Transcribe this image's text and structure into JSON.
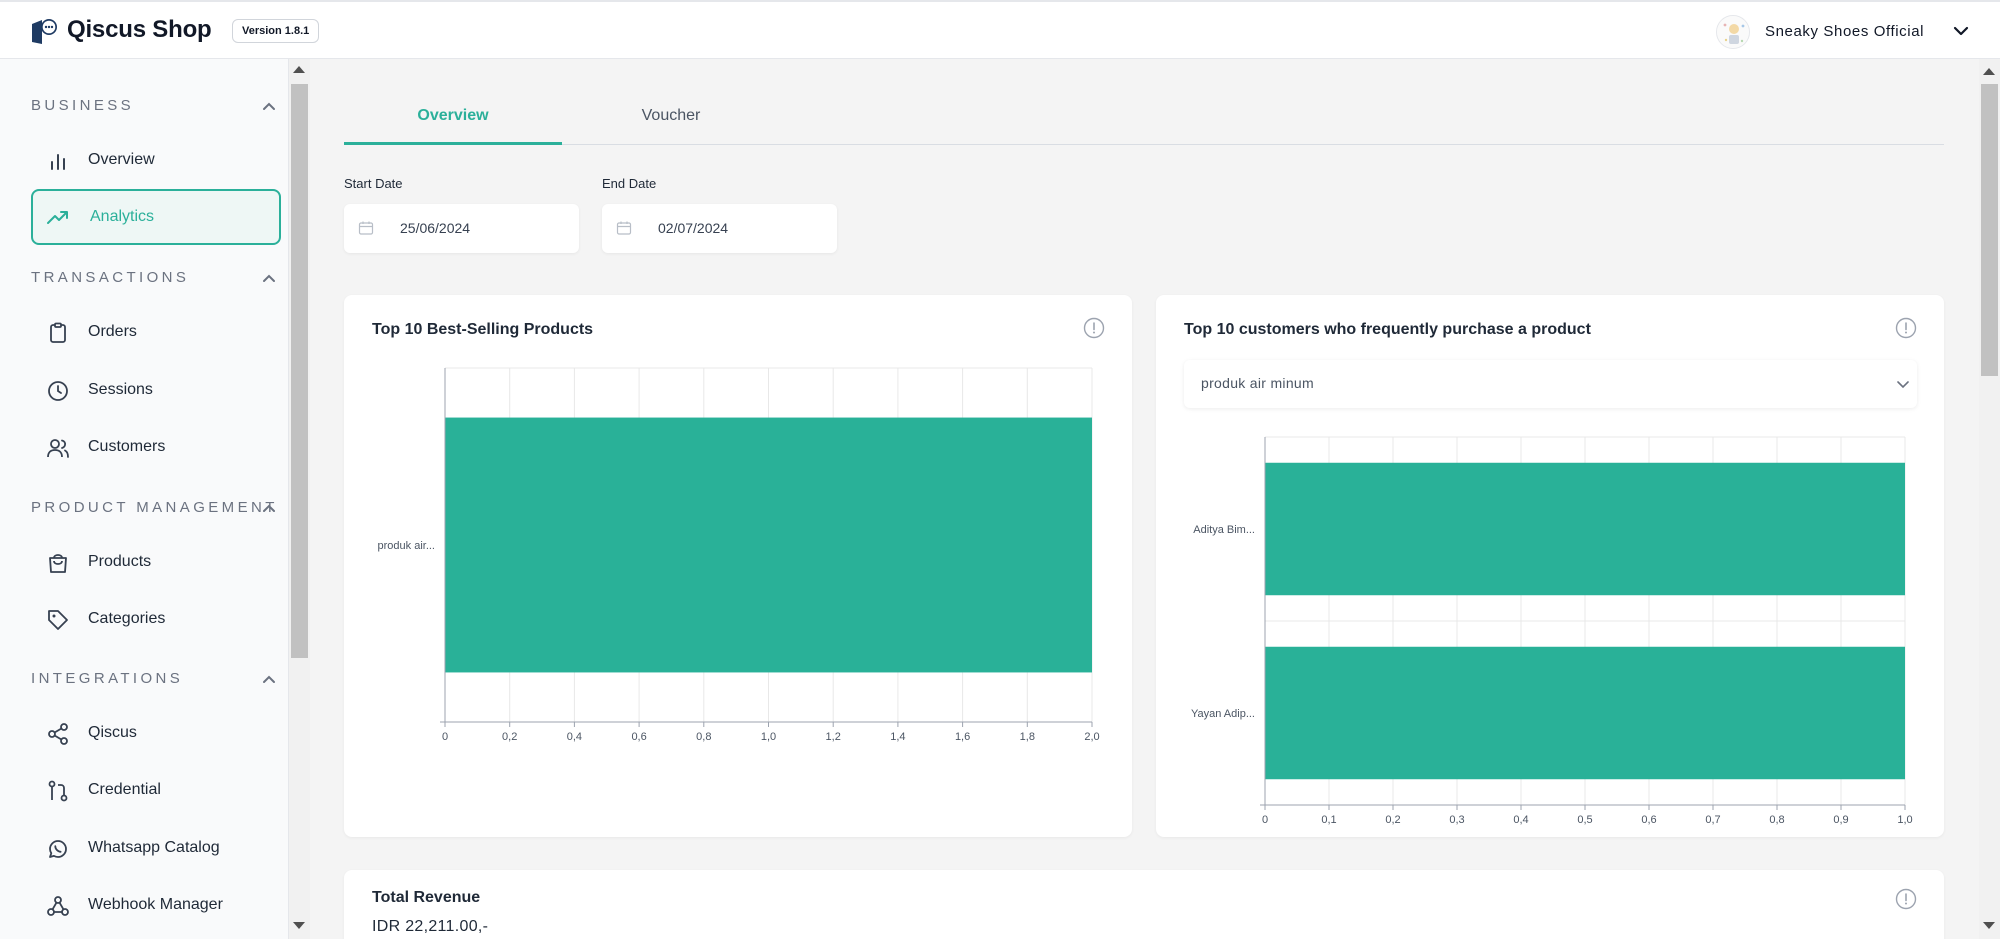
{
  "app": {
    "name": "Qiscus Shop",
    "version": "Version 1.8.1",
    "store_name": "Sneaky Shoes Official"
  },
  "sidebar": {
    "sections": [
      {
        "title": "BUSINESS",
        "items": [
          {
            "label": "Overview",
            "icon": "bar-chart-icon"
          },
          {
            "label": "Analytics",
            "icon": "trending-up-icon",
            "active": true
          }
        ]
      },
      {
        "title": "TRANSACTIONS",
        "items": [
          {
            "label": "Orders",
            "icon": "clipboard-icon"
          },
          {
            "label": "Sessions",
            "icon": "clock-icon"
          },
          {
            "label": "Customers",
            "icon": "users-icon"
          }
        ]
      },
      {
        "title": "PRODUCT MANAGEMENT",
        "items": [
          {
            "label": "Products",
            "icon": "shopping-bag-icon"
          },
          {
            "label": "Categories",
            "icon": "tag-icon"
          }
        ]
      },
      {
        "title": "INTEGRATIONS",
        "items": [
          {
            "label": "Qiscus",
            "icon": "share-icon"
          },
          {
            "label": "Credential",
            "icon": "git-pull-icon"
          },
          {
            "label": "Whatsapp Catalog",
            "icon": "whatsapp-icon"
          },
          {
            "label": "Webhook Manager",
            "icon": "webhook-icon"
          }
        ]
      }
    ]
  },
  "tabs": [
    {
      "label": "Overview",
      "active": true
    },
    {
      "label": "Voucher",
      "active": false
    }
  ],
  "filters": {
    "start_label": "Start Date",
    "start_value": "25/06/2024",
    "end_label": "End Date",
    "end_value": "02/07/2024"
  },
  "cards": {
    "best_selling": {
      "title": "Top 10 Best-Selling Products"
    },
    "top_customers": {
      "title": "Top 10 customers who frequently purchase a product",
      "selected_product": "produk air minum"
    },
    "revenue": {
      "title": "Total Revenue",
      "value": "IDR 22,211.00,-"
    }
  },
  "colors": {
    "accent": "#2bb09a",
    "bar": "#29b198"
  },
  "chart_data": [
    {
      "type": "bar",
      "orientation": "horizontal",
      "title": "Top 10 Best-Selling Products",
      "categories": [
        "produk air..."
      ],
      "values": [
        2
      ],
      "xlim": [
        0,
        2
      ],
      "xticks": [
        "0",
        "0,2",
        "0,4",
        "0,6",
        "0,8",
        "1,0",
        "1,2",
        "1,4",
        "1,6",
        "1,8",
        "2,0"
      ],
      "grid": true
    },
    {
      "type": "bar",
      "orientation": "horizontal",
      "title": "Top 10 customers who frequently purchase a product",
      "categories": [
        "Aditya Bim...",
        "Yayan Adip..."
      ],
      "values": [
        1,
        1
      ],
      "xlim": [
        0,
        1
      ],
      "xticks": [
        "0",
        "0,1",
        "0,2",
        "0,3",
        "0,4",
        "0,5",
        "0,6",
        "0,7",
        "0,8",
        "0,9",
        "1,0"
      ],
      "grid": true
    }
  ]
}
